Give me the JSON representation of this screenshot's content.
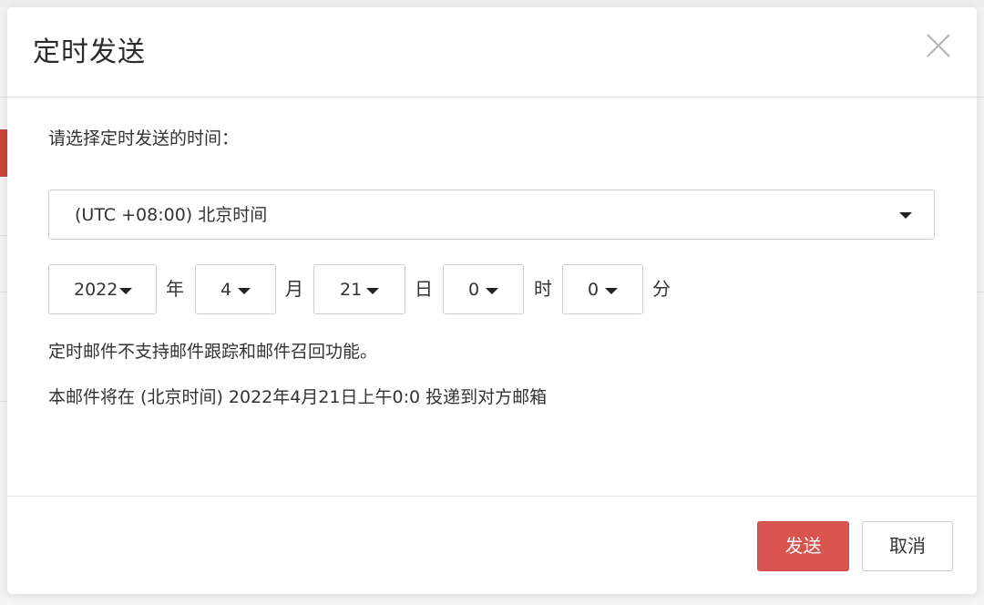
{
  "dialog": {
    "title": "定时发送",
    "prompt": "请选择定时发送的时间：",
    "timezone": "(UTC +08:00) 北京时间",
    "date": {
      "year": "2022",
      "year_unit": "年",
      "month": "4",
      "month_unit": "月",
      "day": "21",
      "day_unit": "日",
      "hour": "0",
      "hour_unit": "时",
      "minute": "0",
      "minute_unit": "分"
    },
    "notice": "定时邮件不支持邮件跟踪和邮件召回功能。",
    "summary": "本邮件将在 (北京时间) 2022年4月21日上午0:0 投递到对方邮箱",
    "send_label": "发送",
    "cancel_label": "取消"
  },
  "colors": {
    "primary_button": "#d9534f",
    "border": "#cfcfcf",
    "text": "#333333"
  },
  "icons": {
    "close": "close-icon",
    "dropdown": "caret-down-icon"
  }
}
